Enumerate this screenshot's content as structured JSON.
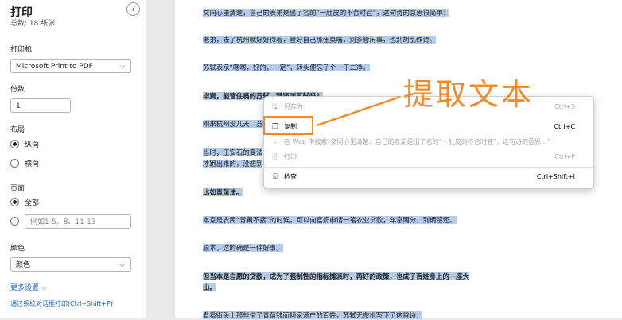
{
  "panel": {
    "title": "打印",
    "subtitle": "总数: 18 纸张",
    "help_icon": "?",
    "printer_label": "打印机",
    "printer_value": "Microsoft Print to PDF",
    "copies_label": "份数",
    "copies_value": "1",
    "layout_label": "布局",
    "layout_options": [
      "纵向",
      "横向"
    ],
    "layout_selected": "纵向",
    "pages_label": "页面",
    "pages_all": "全部",
    "pages_placeholder": "例如1-5、8、11-13",
    "color_label": "颜色",
    "color_value": "颜色",
    "more_settings": "更多设置 ⌵",
    "system_dialog": "通过系统对话框打印(Ctrl+Shift+P)"
  },
  "document": {
    "paragraphs": [
      {
        "text": "文同心里清楚，自己的表弟是出了名的“一肚皮的不合时宜”，这句诗的意思很简单：",
        "bold": false
      },
      {
        "text": "老弟，去了杭州就好好待着，管好自己那张臭嘴，别多管闲事，也别胡乱作诗。",
        "bold": false
      },
      {
        "text": "苏轼表示“嗯嗯，好的，一定”，转头便忘了个一干二净。",
        "bold": false
      },
      {
        "text": "毕竟，能管住嘴的苏轼，那还叫苏轼吗？",
        "bold": true
      },
      {
        "text": "刚来杭州没几天，苏轼",
        "bold": false
      },
      {
        "text": "当时，王安石的变法",
        "bold": false
      },
      {
        "text": "才跑出来的，没想到",
        "bold": false
      },
      {
        "text": "比如青苗法。",
        "bold": true
      },
      {
        "text": "本意是农民“青黄不接”的时候，可以向官府申请一笔农业贷款，年息两分，到期偿还。",
        "bold": false
      },
      {
        "text": "原本，这的确是一件好事。",
        "bold": false
      },
      {
        "text": "但当本是自愿的贷款，成为了强制性的指标摊派时，再好的政策，也成了百姓身上的一座大",
        "bold": true
      },
      {
        "text": "山。",
        "bold": true
      },
      {
        "text": "看看街头上那些借了青苗钱而倾家荡产的百姓，苏轼无奈地写下了这首诗：",
        "bold": false
      }
    ]
  },
  "context_menu": {
    "items": [
      {
        "icon": "save-as-icon",
        "label": "另存为",
        "shortcut": "Ctrl+S",
        "disabled": true
      },
      {
        "icon": "copy-icon",
        "label": "复制",
        "shortcut": "Ctrl+C",
        "disabled": false
      },
      {
        "icon": "search-icon",
        "label": "在 Web 中搜索“文同心里清楚，自己的表弟是出了名的“一肚皮的不合时宜”，这句诗的意思…”",
        "shortcut": "",
        "disabled": true
      },
      {
        "icon": "print-icon",
        "label": "打印",
        "shortcut": "Ctrl+P",
        "disabled": true
      },
      {
        "icon": "inspect-icon",
        "label": "检查",
        "shortcut": "Ctrl+Shift+I",
        "disabled": false
      }
    ]
  },
  "annotation": {
    "text": "提取文本",
    "color": "#f08b2b"
  }
}
